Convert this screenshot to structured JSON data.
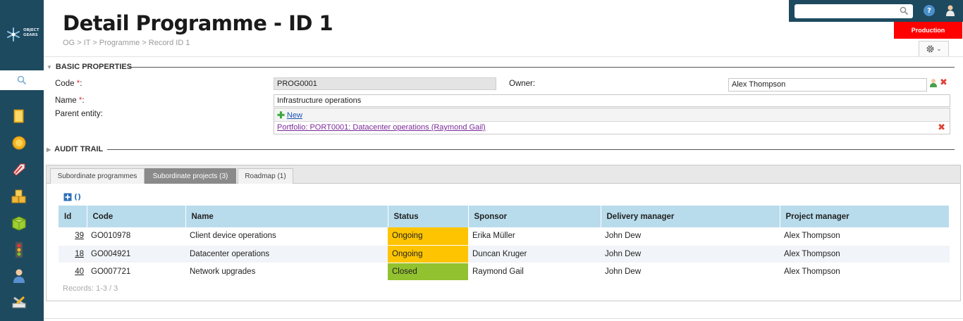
{
  "app": {
    "logo_line1": "OBJECT",
    "logo_line2": "GEARS"
  },
  "page": {
    "title": "Detail Programme - ID 1",
    "breadcrumb": "OG > IT > Programme > Record ID 1",
    "environment": "Production"
  },
  "topbar": {
    "search_placeholder": "",
    "help_label": "?"
  },
  "sidebar": {
    "items": [
      {
        "icon": "folder-icon"
      },
      {
        "icon": "badge-icon"
      },
      {
        "icon": "tag-icon"
      },
      {
        "icon": "boxes-icon"
      },
      {
        "icon": "package-icon"
      },
      {
        "icon": "traffic-light-icon"
      },
      {
        "icon": "user-icon"
      },
      {
        "icon": "tools-icon"
      }
    ]
  },
  "sections": {
    "basic": "BASIC PROPERTIES",
    "audit": "AUDIT TRAIL"
  },
  "form": {
    "code_label": "Code",
    "code_value": "PROG0001",
    "name_label": "Name",
    "name_value": "Infrastructure operations",
    "required_mark": "*",
    "label_suffix": ":",
    "owner_label": "Owner:",
    "owner_value": "Alex Thompson",
    "parent_label": "Parent entity:",
    "new_link": "New",
    "parent_value": "Portfolio: PORT0001: Datacenter operations (Raymond Gail)"
  },
  "tabs": [
    {
      "label": "Subordinate programmes",
      "active": false
    },
    {
      "label": "Subordinate projects (3)",
      "active": true
    },
    {
      "label": "Roadmap (1)",
      "active": false
    }
  ],
  "grid": {
    "columns": [
      "Id",
      "Code",
      "Name",
      "Status",
      "Sponsor",
      "Delivery manager",
      "Project manager"
    ],
    "rows": [
      {
        "id": "39",
        "code": "GO010978",
        "name": "Client device operations",
        "status": "Ongoing",
        "sponsor": "Erika Müller",
        "delivery": "John Dew",
        "pm": "Alex Thompson"
      },
      {
        "id": "18",
        "code": "GO004921",
        "name": "Datacenter operations",
        "status": "Ongoing",
        "sponsor": "Duncan Kruger",
        "delivery": "John Dew",
        "pm": "Alex Thompson"
      },
      {
        "id": "40",
        "code": "GO007721",
        "name": "Network upgrades",
        "status": "Closed",
        "sponsor": "Raymond Gail",
        "delivery": "John Dew",
        "pm": "Alex Thompson"
      }
    ],
    "records": "Records: 1-3 / 3"
  },
  "colors": {
    "sidebar": "#1e4a5f",
    "env_badge": "#ff0000",
    "header_row": "#b9dcec",
    "status_ongoing": "#fec402",
    "status_closed": "#92c22f"
  }
}
